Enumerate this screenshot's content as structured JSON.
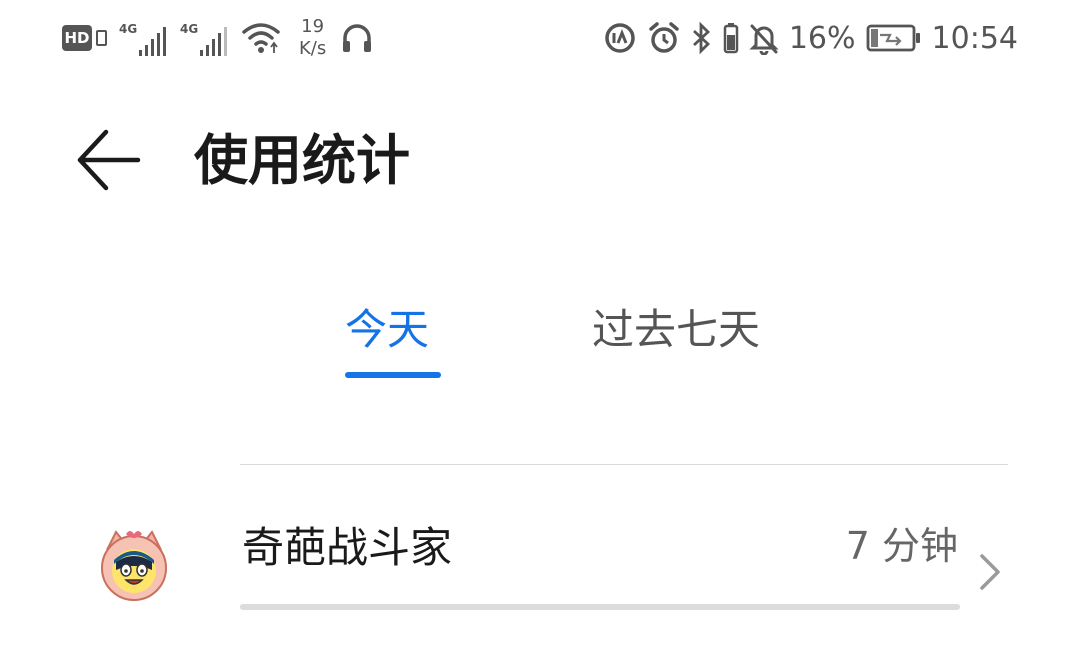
{
  "status_bar": {
    "hd_label": "HD",
    "signal1_label": "4G",
    "signal2_label": "4G",
    "speed_value": "19",
    "speed_unit": "K/s",
    "battery_percent": "16%",
    "time": "10:54",
    "icons": [
      "hd-icon",
      "sim-icon",
      "signal-icon",
      "signal-icon",
      "wifi-icon",
      "headphones-icon",
      "data-saver-icon",
      "alarm-icon",
      "bluetooth-icon",
      "battery-small-icon",
      "bell-off-icon",
      "battery-icon"
    ]
  },
  "header": {
    "back_icon": "back-arrow-icon",
    "title": "使用统计"
  },
  "tabs": [
    {
      "label": "今天",
      "selected": true
    },
    {
      "label": "过去七天",
      "selected": false
    }
  ],
  "colors": {
    "accent": "#1473e6",
    "text_primary": "#1a1a1a",
    "text_secondary": "#666666",
    "divider": "#d9d9d9"
  },
  "usage_list": [
    {
      "app_name": "奇葩战斗家",
      "usage_time": "7 分钟",
      "usage_fraction": 1.0,
      "icon": "app-avatar-icon"
    }
  ]
}
